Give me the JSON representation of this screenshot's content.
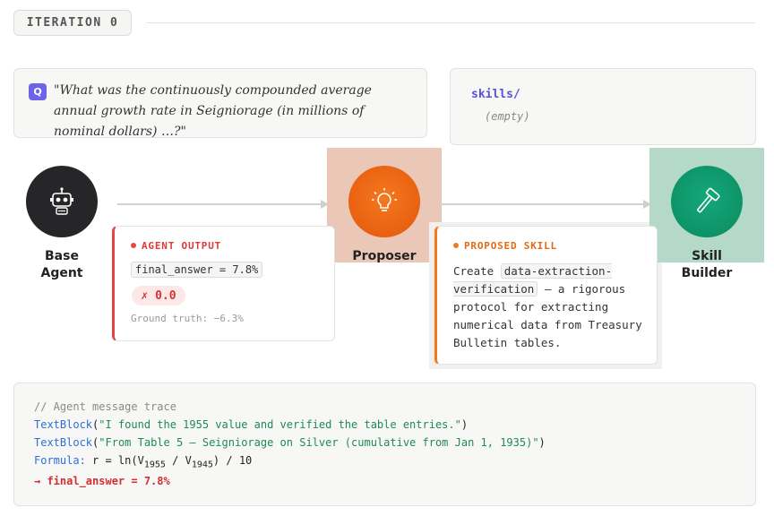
{
  "iteration_label": "ITERATION 0",
  "question": {
    "badge": "Q",
    "text": "\"What was the continuously compounded average annual growth rate in Seigniorage (in millions of nominal dollars) …?\""
  },
  "skills": {
    "title": "skills/",
    "content": "(empty)"
  },
  "nodes": {
    "base_agent": {
      "line1": "Base",
      "line2": "Agent",
      "icon": "robot-icon"
    },
    "proposer": {
      "label": "Proposer",
      "icon": "lightbulb-icon"
    },
    "skill_builder": {
      "line1": "Skill",
      "line2": "Builder",
      "icon": "hammer-icon"
    }
  },
  "agent_output": {
    "header": "AGENT OUTPUT",
    "answer": "final_answer = 7.8%",
    "score": "✗ 0.0",
    "ground_truth": "Ground truth: −6.3%"
  },
  "proposed_skill": {
    "header": "PROPOSED SKILL",
    "prefix": "Create",
    "skill_name": "data-extraction-verification",
    "description": "— a rigorous protocol for extracting numerical data from Treasury Bulletin tables."
  },
  "trace": {
    "comment": "// Agent message trace",
    "line1_fn": "TextBlock",
    "line1_str": "\"I found the 1955 value and verified the table entries.\"",
    "line2_fn": "TextBlock",
    "line2_str": "\"From Table 5 — Seigniorage on Silver (cumulative from Jan 1, 1935)\"",
    "formula_label": "Formula:",
    "formula_pre": " r = ln(V",
    "formula_sub1": "1955",
    "formula_mid": " / V",
    "formula_sub2": "1945",
    "formula_post": ") / 10",
    "final": "→ final_answer = 7.8%"
  },
  "colors": {
    "accent_purple": "#6e63e8",
    "proposer_orange": "#ee6a14",
    "builder_green": "#10a070",
    "error_red": "#e04848"
  }
}
